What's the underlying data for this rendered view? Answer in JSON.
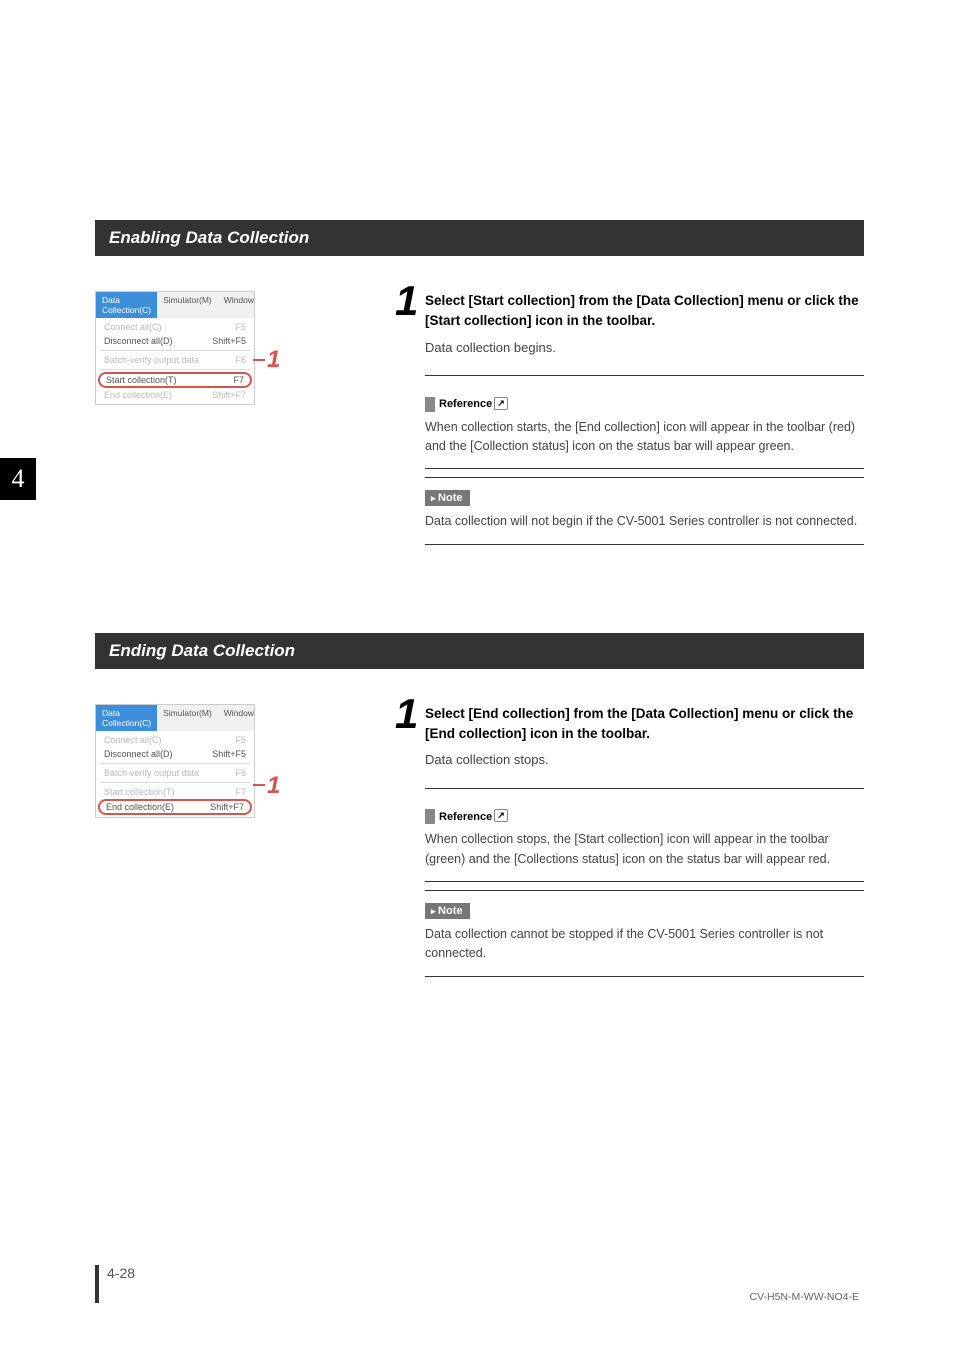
{
  "side_tab": "4",
  "sections": {
    "enabling": {
      "title": "Enabling Data Collection",
      "menu": {
        "tabs": [
          "Data Collection(C)",
          "Simulator(M)",
          "Window"
        ],
        "items": [
          {
            "label": "Connect all(C)",
            "shortcut": "F5",
            "disabled": true
          },
          {
            "label": "Disconnect all(D)",
            "shortcut": "Shift+F5"
          },
          {
            "label": "Batch-verify output data",
            "shortcut": "F6",
            "disabled": true
          },
          {
            "label": "Start collection(T)",
            "shortcut": "F7",
            "highlight": true
          },
          {
            "label": "End collection(E)",
            "shortcut": "Shift+F7",
            "disabled": true
          }
        ]
      },
      "callout": "1",
      "step_num": "1",
      "step_title": "Select [Start collection] from the [Data Collection] menu or click the [Start collection] icon in the toolbar.",
      "step_body": "Data collection begins.",
      "ref_label": "Reference",
      "ref_body": "When collection starts, the [End collection] icon will appear in the toolbar (red) and the [Collection status] icon on the status bar will appear green.",
      "note_label": "Note",
      "note_body": "Data collection will not begin if the CV-5001 Series controller is not connected."
    },
    "ending": {
      "title": "Ending Data Collection",
      "menu": {
        "tabs": [
          "Data Collection(C)",
          "Simulator(M)",
          "Window"
        ],
        "items": [
          {
            "label": "Connect all(C)",
            "shortcut": "F5",
            "disabled": true
          },
          {
            "label": "Disconnect all(D)",
            "shortcut": "Shift+F5"
          },
          {
            "label": "Batch-verify output data",
            "shortcut": "F6",
            "disabled": true
          },
          {
            "label": "Start collection(T)",
            "shortcut": "F7",
            "disabled": true
          },
          {
            "label": "End collection(E)",
            "shortcut": "Shift+F7",
            "highlight": true
          }
        ]
      },
      "callout": "1",
      "step_num": "1",
      "step_title": "Select [End collection] from the [Data Collection] menu or click the [End collection] icon in the toolbar.",
      "step_body": "Data collection stops.",
      "ref_label": "Reference",
      "ref_body": "When collection stops, the [Start collection] icon will appear in the toolbar (green) and the [Collections status] icon on the status bar will appear red.",
      "note_label": "Note",
      "note_body": "Data collection cannot be stopped if the CV-5001 Series controller is not connected."
    }
  },
  "footer": {
    "page_num": "4-28",
    "doc_id": "CV-H5N-M-WW-NO4-E"
  }
}
